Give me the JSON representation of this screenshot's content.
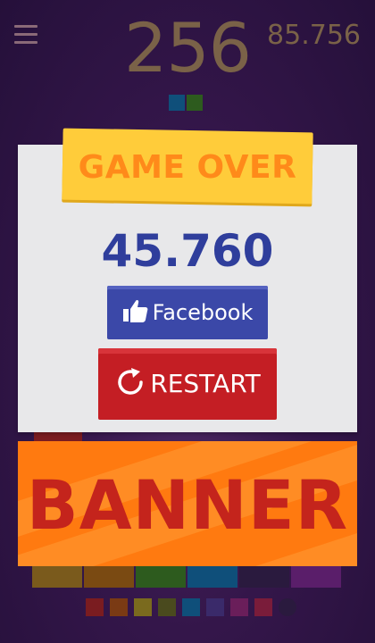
{
  "header": {
    "menu_icon": "hamburger-menu-icon",
    "score": "256",
    "best_score": "85.756",
    "next_tiles": [
      "#0f4f7a",
      "#2d5b1e"
    ]
  },
  "board": {
    "row_colors": [
      "#7a5a1c",
      "#7a4a12",
      "#2d5b1e",
      "#0f4f7a",
      "#2a1a3e",
      "#2a1a3e",
      "#5a1e6a"
    ],
    "palette": [
      "#7a1c20",
      "#7a3a14",
      "#7a6a1e",
      "#4a4a1e",
      "#0f4f7a",
      "#3a2a6a",
      "#6a1e5a",
      "#7a1c3a",
      "#2a1a3e"
    ]
  },
  "dialog": {
    "title": "GAME OVER",
    "final_score": "45.760",
    "facebook_label": "Facebook",
    "facebook_icon": "thumbs-up-icon",
    "restart_label": "RESTART",
    "restart_icon": "restart-arrow-icon"
  },
  "ad": {
    "text": "BANNER"
  },
  "colors": {
    "title_yellow": "#ffcc3a",
    "title_text": "#ff8a1a",
    "score_blue": "#2f3e9c",
    "facebook_blue": "#3b48a8",
    "restart_red": "#c41e24",
    "banner_orange": "#ff7a10",
    "banner_text": "#c4241c"
  }
}
